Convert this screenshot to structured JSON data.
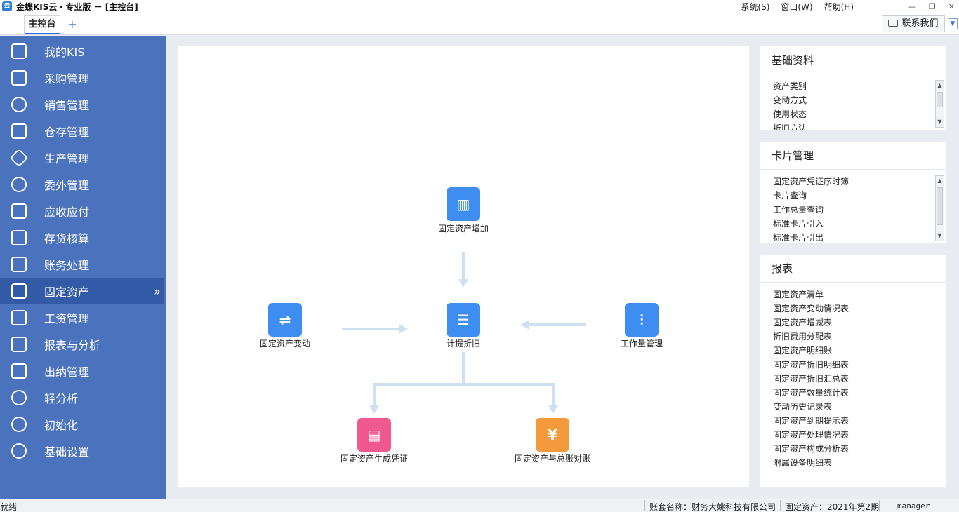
{
  "window": {
    "title": "金蝶KIS云・专业版 － [主控台]",
    "logo_glyph": "云",
    "menus": [
      {
        "label": "系统(S)"
      },
      {
        "label": "窗口(W)"
      },
      {
        "label": "帮助(H)"
      }
    ],
    "controls": {
      "minimize": "—",
      "restore": "❐",
      "close": "✕"
    }
  },
  "tabs": {
    "main_label": "主控台",
    "add_glyph": "+",
    "contact_label": "联系我们",
    "collapse_glyph": "▼"
  },
  "sidebar": {
    "items": [
      {
        "label": "我的KIS",
        "icon": "monitor-icon"
      },
      {
        "label": "采购管理",
        "icon": "shopping-bag-icon"
      },
      {
        "label": "销售管理",
        "icon": "users-icon"
      },
      {
        "label": "仓存管理",
        "icon": "warehouse-icon"
      },
      {
        "label": "生产管理",
        "icon": "gear-hex-icon"
      },
      {
        "label": "委外管理",
        "icon": "outsource-icon"
      },
      {
        "label": "应收应付",
        "icon": "yen-icon"
      },
      {
        "label": "存货核算",
        "icon": "inventory-search-icon"
      },
      {
        "label": "账务处理",
        "icon": "ledger-icon"
      },
      {
        "label": "固定资产",
        "icon": "building-icon",
        "active": true,
        "arrow": "»"
      },
      {
        "label": "工资管理",
        "icon": "salary-icon"
      },
      {
        "label": "报表与分析",
        "icon": "chart-icon"
      },
      {
        "label": "出纳管理",
        "icon": "cashier-icon"
      },
      {
        "label": "轻分析",
        "icon": "analysis-icon"
      },
      {
        "label": "初始化",
        "icon": "init-icon"
      },
      {
        "label": "基础设置",
        "icon": "settings-icon"
      }
    ]
  },
  "flow": {
    "nodes": [
      {
        "id": "add",
        "label": "固定资产增加",
        "glyph": "▥",
        "color": "#3d8ef0",
        "icon": "building-icon"
      },
      {
        "id": "change",
        "label": "固定资产变动",
        "glyph": "⇌",
        "color": "#3d8ef0",
        "icon": "exchange-icon"
      },
      {
        "id": "depr",
        "label": "计提折旧",
        "glyph": "☰",
        "color": "#3d8ef0",
        "icon": "document-gear-icon"
      },
      {
        "id": "workload",
        "label": "工作量管理",
        "glyph": "⫶",
        "color": "#3d8ef0",
        "icon": "sliders-icon"
      },
      {
        "id": "voucher",
        "label": "固定资产生成凭证",
        "glyph": "▤",
        "color": "#f0598e",
        "icon": "voucher-icon"
      },
      {
        "id": "reconcile",
        "label": "固定资产与总账对账",
        "glyph": "¥",
        "color": "#f39a3c",
        "icon": "reconcile-chart-icon"
      }
    ]
  },
  "panels": {
    "basic": {
      "title": "基础资料",
      "items": [
        "资产类别",
        "变动方式",
        "使用状态",
        "折旧方法"
      ]
    },
    "card": {
      "title": "卡片管理",
      "items": [
        "固定资产凭证序时簿",
        "卡片查询",
        "工作总量查询",
        "标准卡片引入",
        "标准卡片引出"
      ]
    },
    "reports": {
      "title": "报表",
      "items": [
        "固定资产清单",
        "固定资产变动情况表",
        "固定资产增减表",
        "折旧费用分配表",
        "固定资产明细账",
        "固定资产折旧明细表",
        "固定资产折旧汇总表",
        "固定资产数量统计表",
        "变动历史记录表",
        "固定资产到期提示表",
        "固定资产处理情况表",
        "固定资产构成分析表",
        "附属设备明细表"
      ]
    },
    "scroll": {
      "up": "▲",
      "down": "▼"
    }
  },
  "status": {
    "ready": "就绪",
    "account": "账套名称：财务大姚科技有限公司",
    "period": "固定资产：2021年第2期",
    "user": "manager"
  }
}
